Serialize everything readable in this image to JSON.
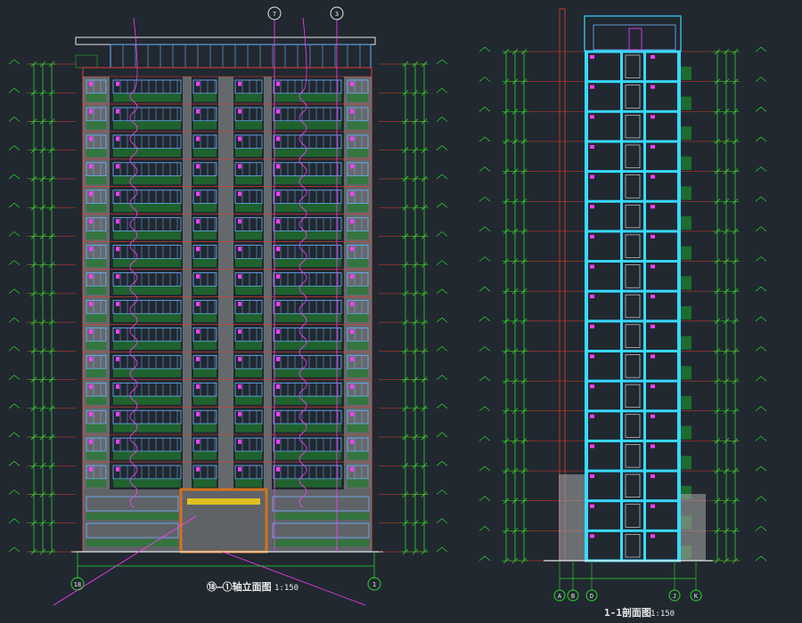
{
  "theme": {
    "background": "#212830",
    "dimension_green": "#2bd62b",
    "outline_red": "#e23b2b",
    "elevation_white": "#e8e8e8",
    "window_blue": "#6fb6ff",
    "accent_magenta": "#ff3cff",
    "structure_cyan": "#38d9ff",
    "balcony_green": "#1f7a2e",
    "wall_gray": "#9e9e9e",
    "entrance_orange": "#d2731e",
    "entrance_yellow": "#e0c020"
  },
  "elevation": {
    "title": "⑱—①轴立面图",
    "scale": "1:150",
    "axis_left": "18",
    "axis_right": "1",
    "top_axis_markers": [
      "7",
      "3"
    ]
  },
  "section": {
    "title": "1-1剖面图",
    "scale": "1:150",
    "axes": [
      "A",
      "B",
      "D",
      "J",
      "K"
    ]
  },
  "floor_count": 17
}
